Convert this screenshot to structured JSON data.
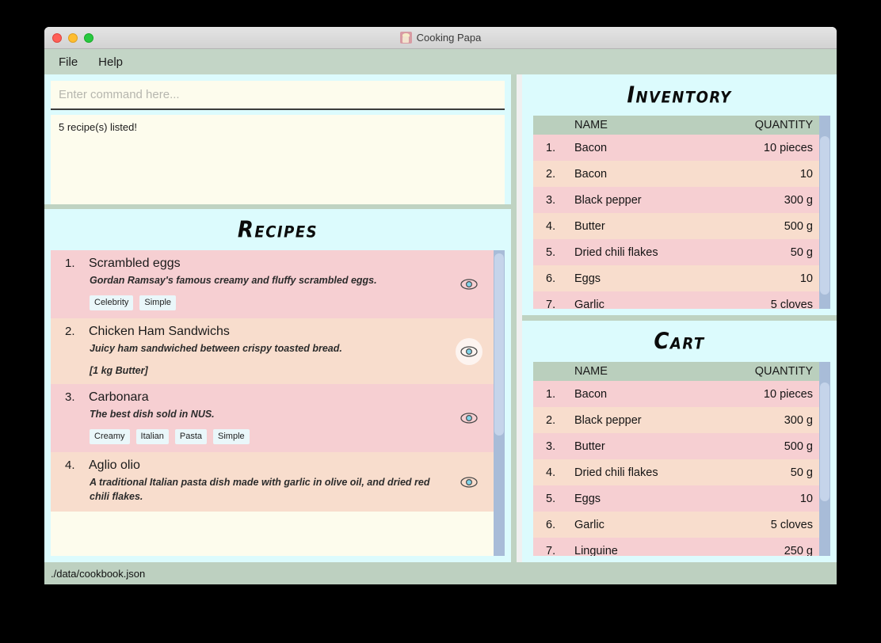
{
  "window": {
    "title": "Cooking Papa",
    "app_icon": "chef-icon",
    "traffic_lights": [
      "close",
      "minimize",
      "maximize"
    ]
  },
  "menubar": {
    "items": [
      {
        "label": "File"
      },
      {
        "label": "Help"
      }
    ]
  },
  "command": {
    "placeholder": "Enter command here...",
    "value": ""
  },
  "output": {
    "text": "5 recipe(s) listed!"
  },
  "recipes_panel": {
    "heading": "Recipes",
    "eye_icon": "eye-icon",
    "items": [
      {
        "index": "1.",
        "name": "Scrambled eggs",
        "description": "Gordan Ramsay's famous creamy and fluffy scrambled eggs.",
        "ingredients": "",
        "tags": [
          "Celebrity",
          "Simple"
        ],
        "hovered": false
      },
      {
        "index": "2.",
        "name": "Chicken Ham Sandwichs",
        "description": "Juicy ham sandwiched between crispy toasted bread.",
        "ingredients": "[1 kg Butter]",
        "tags": [],
        "hovered": true
      },
      {
        "index": "3.",
        "name": "Carbonara",
        "description": "The best dish sold in NUS.",
        "ingredients": "",
        "tags": [
          "Creamy",
          "Italian",
          "Pasta",
          "Simple"
        ],
        "hovered": false
      },
      {
        "index": "4.",
        "name": "Aglio olio",
        "description": "A traditional Italian pasta dish made with garlic in olive oil, and dried red chili flakes.",
        "ingredients": "",
        "tags": [],
        "hovered": false
      }
    ]
  },
  "inventory_panel": {
    "heading": "Inventory",
    "columns": {
      "index": "",
      "name": "NAME",
      "quantity": "QUANTITY"
    },
    "rows": [
      {
        "index": "1.",
        "name": "Bacon",
        "quantity": "10 pieces"
      },
      {
        "index": "2.",
        "name": "Bacon",
        "quantity": "10"
      },
      {
        "index": "3.",
        "name": "Black pepper",
        "quantity": "300 g"
      },
      {
        "index": "4.",
        "name": "Butter",
        "quantity": "500 g"
      },
      {
        "index": "5.",
        "name": "Dried chili flakes",
        "quantity": "50 g"
      },
      {
        "index": "6.",
        "name": "Eggs",
        "quantity": "10"
      },
      {
        "index": "7.",
        "name": "Garlic",
        "quantity": "5 cloves"
      }
    ]
  },
  "cart_panel": {
    "heading": "Cart",
    "columns": {
      "index": "",
      "name": "NAME",
      "quantity": "QUANTITY"
    },
    "rows": [
      {
        "index": "1.",
        "name": "Bacon",
        "quantity": "10 pieces"
      },
      {
        "index": "2.",
        "name": "Black pepper",
        "quantity": "300 g"
      },
      {
        "index": "3.",
        "name": "Butter",
        "quantity": "500 g"
      },
      {
        "index": "4.",
        "name": "Dried chili flakes",
        "quantity": "50 g"
      },
      {
        "index": "5.",
        "name": "Eggs",
        "quantity": "10"
      },
      {
        "index": "6.",
        "name": "Garlic",
        "quantity": "5 cloves"
      },
      {
        "index": "7.",
        "name": "Linguine",
        "quantity": "250 g"
      }
    ]
  },
  "statusbar": {
    "path": "./data/cookbook.json"
  },
  "colors": {
    "menubar": "#c3d5c6",
    "panel_background": "#dcfbfd",
    "row_odd": "#f6cfd2",
    "row_even": "#f8ddcd",
    "table_header": "#bacfbd",
    "input_background": "#fdfced",
    "divider": "#bfd3c2",
    "scrollbar_track": "#a8bcd8",
    "scrollbar_thumb": "#c5d4ea",
    "tag_background": "#eaf7fa",
    "eye_pupil": "#7fd3e8"
  }
}
